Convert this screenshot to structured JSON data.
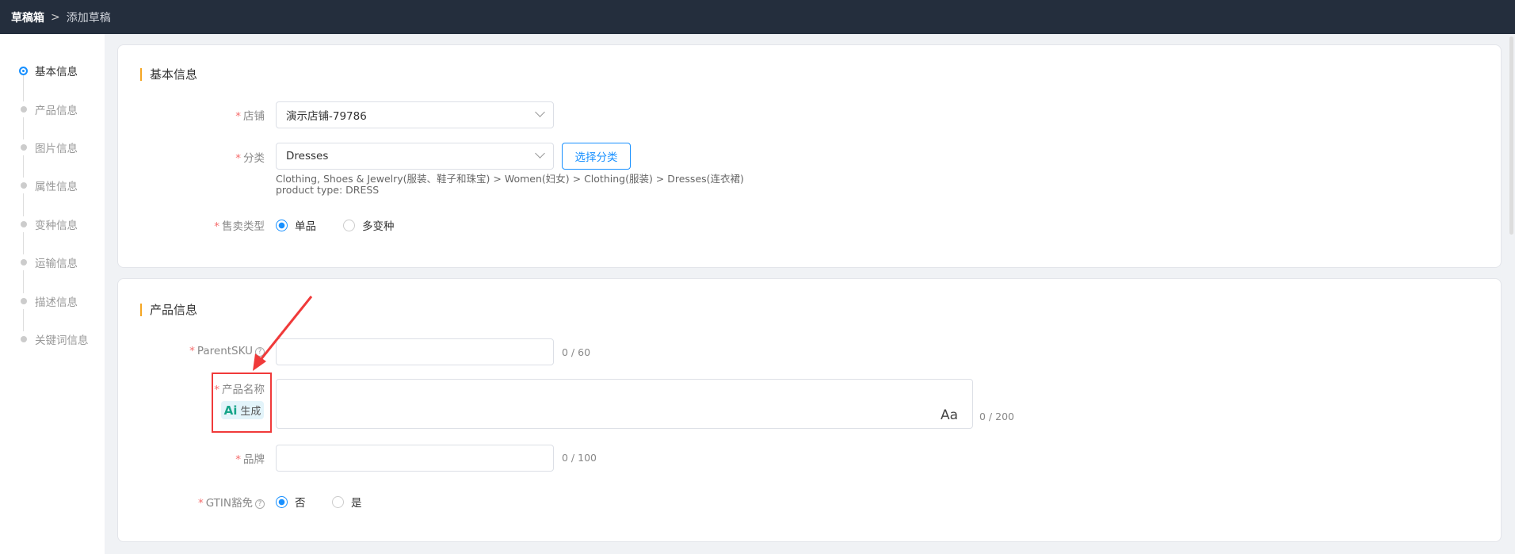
{
  "header": {
    "breadcrumb_root": "草稿箱",
    "breadcrumb_sep": ">",
    "breadcrumb_current": "添加草稿"
  },
  "sidebar": {
    "steps": [
      {
        "label": "基本信息"
      },
      {
        "label": "产品信息"
      },
      {
        "label": "图片信息"
      },
      {
        "label": "属性信息"
      },
      {
        "label": "变种信息"
      },
      {
        "label": "运输信息"
      },
      {
        "label": "描述信息"
      },
      {
        "label": "关键词信息"
      }
    ]
  },
  "basic": {
    "title": "基本信息",
    "required": "*",
    "store_label": "店铺",
    "store_value": "演示店铺-79786",
    "category_label": "分类",
    "category_value": "Dresses",
    "select_category": "选择分类",
    "category_path": "Clothing, Shoes & Jewelry(服装、鞋子和珠宝) > Women(妇女) > Clothing(服装) > Dresses(连衣裙)",
    "product_type": "product type: DRESS",
    "sell_type_label": "售卖类型",
    "sell_single": "单品",
    "sell_multi": "多变种"
  },
  "product": {
    "title": "产品信息",
    "parent_sku_label": "ParentSKU",
    "parent_sku_count": "0 / 60",
    "name_label": "产品名称",
    "ai_icon": "Ai",
    "ai_generate": "生成",
    "name_case": "Aa",
    "name_count": "0 / 200",
    "brand_label": "品牌",
    "brand_count": "0 / 100",
    "gtin_label": "GTIN豁免",
    "gtin_no": "否",
    "gtin_yes": "是",
    "help": "?"
  },
  "colors": {
    "accent": "#1890ff",
    "header": "#242e3d",
    "annotation": "#f03a3a"
  }
}
